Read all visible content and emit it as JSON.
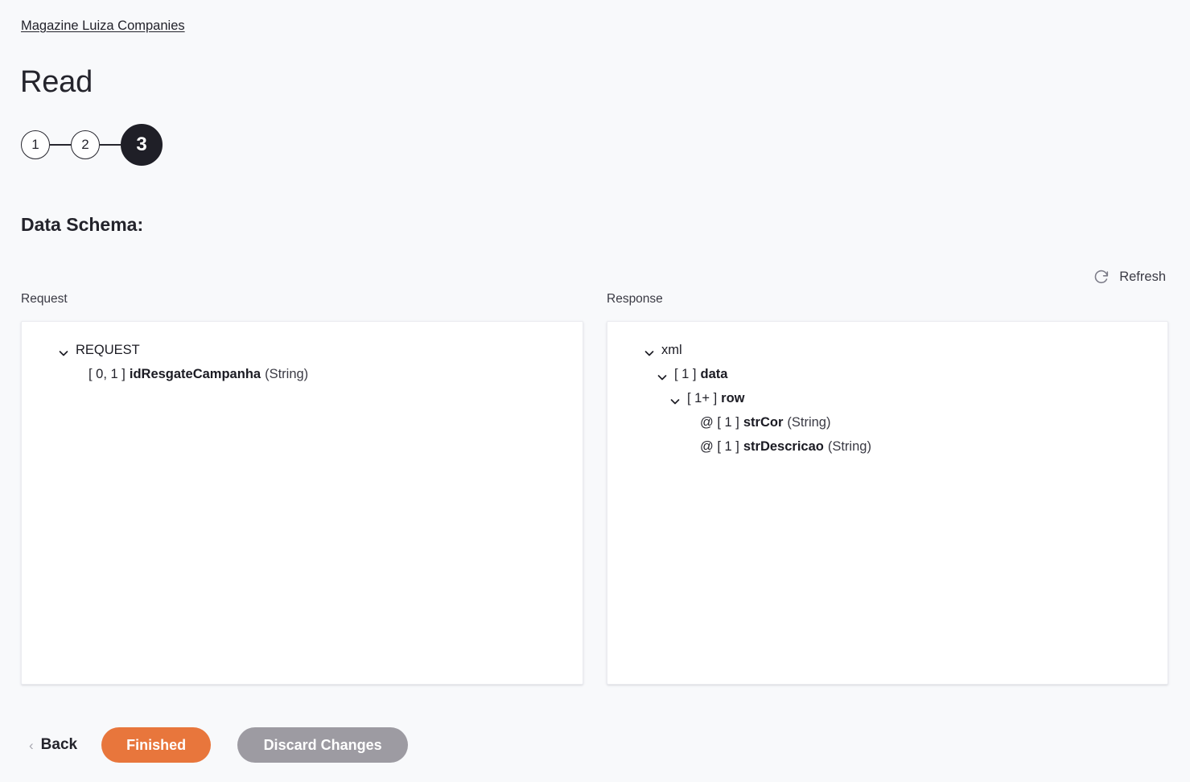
{
  "breadcrumb": {
    "label": "Magazine Luiza Companies"
  },
  "header": {
    "title": "Read"
  },
  "stepper": {
    "steps": [
      {
        "label": "1",
        "state": "complete"
      },
      {
        "label": "2",
        "state": "complete"
      },
      {
        "label": "3",
        "state": "active"
      }
    ]
  },
  "section": {
    "title": "Data Schema:"
  },
  "toolbar": {
    "refresh_label": "Refresh",
    "refresh_icon": "refresh-icon"
  },
  "schema": {
    "request": {
      "label": "Request",
      "nodes": [
        {
          "indent": 1,
          "chevron": "chevron-down-icon",
          "prefix": "",
          "name": "REQUEST",
          "bold": false,
          "type": ""
        },
        {
          "indent": 2,
          "chevron": "",
          "prefix": "[ 0, 1 ]",
          "name": "idResgateCampanha",
          "bold": true,
          "type": "(String)"
        }
      ]
    },
    "response": {
      "label": "Response",
      "nodes": [
        {
          "indent": 1,
          "chevron": "chevron-down-icon",
          "prefix": "",
          "name": "xml",
          "bold": false,
          "type": ""
        },
        {
          "indent": 2,
          "chevron": "chevron-down-icon",
          "prefix": "[ 1 ]",
          "name": "data",
          "bold": true,
          "type": ""
        },
        {
          "indent": 3,
          "chevron": "chevron-down-icon",
          "prefix": "[ 1+ ]",
          "name": "row",
          "bold": true,
          "type": ""
        },
        {
          "indent": 4,
          "chevron": "",
          "prefix": "@ [ 1 ]",
          "name": "strCor",
          "bold": true,
          "type": "(String)"
        },
        {
          "indent": 4,
          "chevron": "",
          "prefix": "@ [ 1 ]",
          "name": "strDescricao",
          "bold": true,
          "type": "(String)"
        }
      ]
    }
  },
  "footer": {
    "back_label": "Back",
    "back_chevron": "‹",
    "finished_label": "Finished",
    "discard_label": "Discard Changes"
  },
  "colors": {
    "page_background": "#f8f9fb",
    "panel_background": "#ffffff",
    "text": "#23232b",
    "accent_orange": "#e8763c",
    "neutral_gray": "#9d9ba2",
    "step_active": "#1f1f27"
  }
}
